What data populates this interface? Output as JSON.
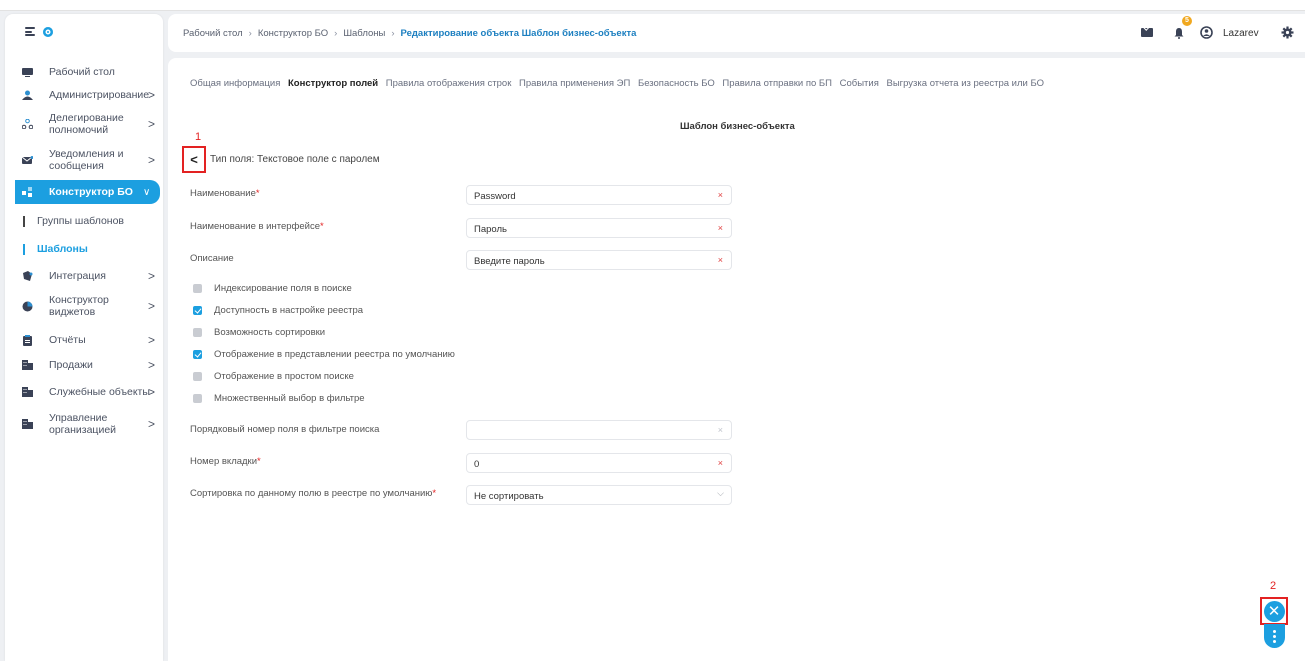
{
  "breadcrumbs": [
    "Рабочий стол",
    "Конструктор БО",
    "Шаблоны",
    "Редактирование объекта Шаблон бизнес-объекта"
  ],
  "header": {
    "notification_count": "5",
    "username": "Lazarev"
  },
  "sidebar": {
    "items": [
      {
        "label": "Рабочий стол",
        "icon": "desktop-icon"
      },
      {
        "label": "Администрирование",
        "icon": "admin-icon",
        "chevron": ">"
      },
      {
        "label": "Делегирование\nполномочий",
        "icon": "delegation-icon",
        "chevron": ">"
      },
      {
        "label": "Уведомления и\nсообщения",
        "icon": "notifications-icon",
        "chevron": ">"
      },
      {
        "label": "Конструктор БО",
        "icon": "constructor-icon",
        "chevron": "∨"
      },
      {
        "label": "Группы шаблонов"
      },
      {
        "label": "Шаблоны"
      },
      {
        "label": "Интеграция",
        "icon": "integration-icon",
        "chevron": ">"
      },
      {
        "label": "Конструктор\nвиджетов",
        "icon": "widgets-icon",
        "chevron": ">"
      },
      {
        "label": "Отчёты",
        "icon": "reports-icon",
        "chevron": ">"
      },
      {
        "label": "Продажи",
        "icon": "sales-icon",
        "chevron": ">"
      },
      {
        "label": "Служебные объекты",
        "icon": "service-icon",
        "chevron": ">"
      },
      {
        "label": "Управление\nорганизацией",
        "icon": "organization-icon",
        "chevron": ">"
      }
    ]
  },
  "tabs": [
    "Общая информация",
    "Конструктор полей",
    "Правила отображения строк",
    "Правила применения ЭП",
    "Безопасность БО",
    "Правила отправки по БП",
    "События",
    "Выгрузка отчета из реестра или БО"
  ],
  "active_tab": "Конструктор полей",
  "form": {
    "title": "Шаблон бизнес-объекта",
    "back_label": "<",
    "field_type": "Тип поля: Текстовое поле с паролем",
    "name_label": "Наименование",
    "name_value": "Password",
    "ui_name_label": "Наименование в интерфейсе",
    "ui_name_value": "Пароль",
    "description_label": "Описание",
    "description_value": "Введите пароль",
    "required_mark": "*",
    "clear_symbol": "×",
    "checkboxes": [
      {
        "label": "Индексирование поля в поиске",
        "checked": false
      },
      {
        "label": "Доступность в настройке реестра",
        "checked": true
      },
      {
        "label": "Возможность сортировки",
        "checked": false
      },
      {
        "label": "Отображение в представлении реестра по умолчанию",
        "checked": true
      },
      {
        "label": "Отображение в простом поиске",
        "checked": false
      },
      {
        "label": "Множественный выбор в фильтре",
        "checked": false
      }
    ],
    "order_label": "Порядковый номер поля в фильтре поиска",
    "order_value": "",
    "tab_number_label": "Номер вкладки",
    "tab_number_value": "0",
    "sort_label": "Сортировка по данному полю в реестре по умолчанию",
    "sort_value": "Не сортировать"
  },
  "annotations": {
    "mark1": "1",
    "mark2": "2"
  },
  "colors": {
    "accent": "#1c9fe0",
    "highlight": "#e32222"
  }
}
